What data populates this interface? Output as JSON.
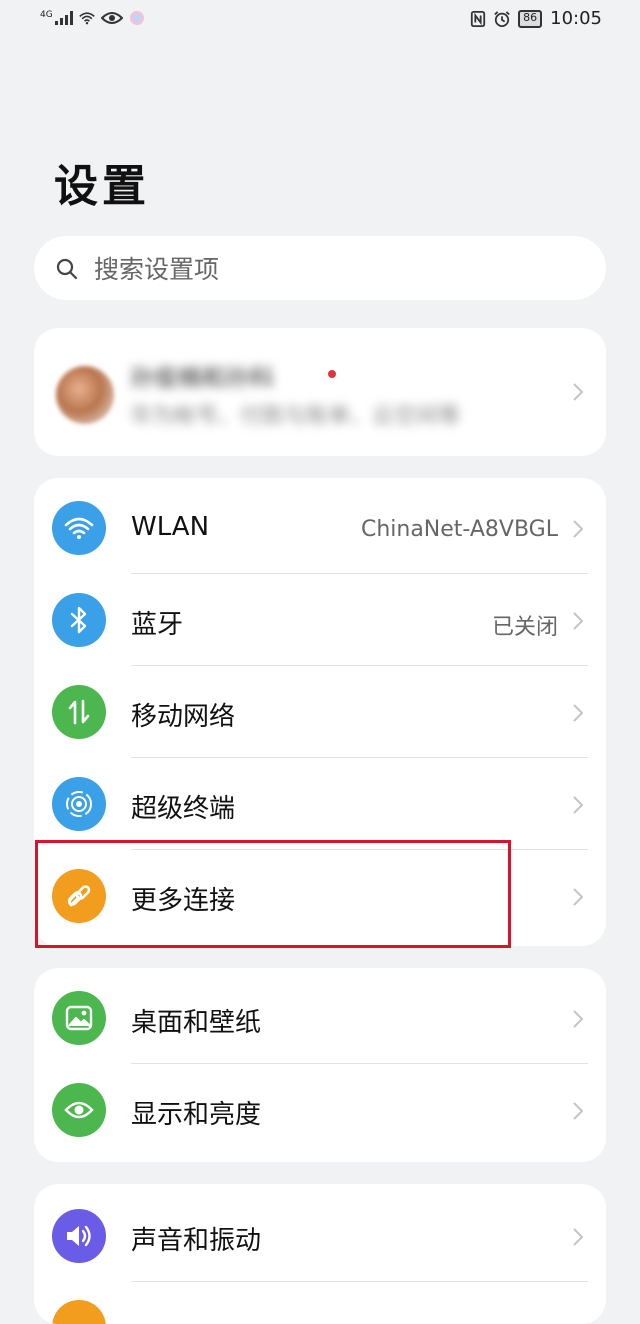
{
  "status_bar": {
    "network_type": "4G",
    "battery_level": "86",
    "time": "10:05"
  },
  "title": "设置",
  "search": {
    "placeholder": "搜索设置项"
  },
  "account": {
    "name": "孙俊楠和孙科",
    "subtitle": "华为帐号、付款与账单、云空间等"
  },
  "sections": [
    {
      "items": [
        {
          "label": "WLAN",
          "value": "ChinaNet-A8VBGL",
          "icon": "wifi-icon",
          "color": "#3aa0e8"
        },
        {
          "label": "蓝牙",
          "value": "已关闭",
          "icon": "bluetooth-icon",
          "color": "#3aa0e8"
        },
        {
          "label": "移动网络",
          "value": "",
          "icon": "mobile-data-icon",
          "color": "#4cb74e"
        },
        {
          "label": "超级终端",
          "value": "",
          "icon": "super-device-icon",
          "color": "#3aa0e8"
        },
        {
          "label": "更多连接",
          "value": "",
          "icon": "link-icon",
          "color": "#f29d1e"
        }
      ]
    },
    {
      "items": [
        {
          "label": "桌面和壁纸",
          "value": "",
          "icon": "wallpaper-icon",
          "color": "#4cb74e"
        },
        {
          "label": "显示和亮度",
          "value": "",
          "icon": "eye-icon",
          "color": "#4cb74e"
        }
      ]
    },
    {
      "items": [
        {
          "label": "声音和振动",
          "value": "",
          "icon": "speaker-icon",
          "color": "#6a5ce6"
        }
      ]
    }
  ],
  "colors": {
    "background": "#f1f2f4",
    "highlight": "#d9142a"
  }
}
